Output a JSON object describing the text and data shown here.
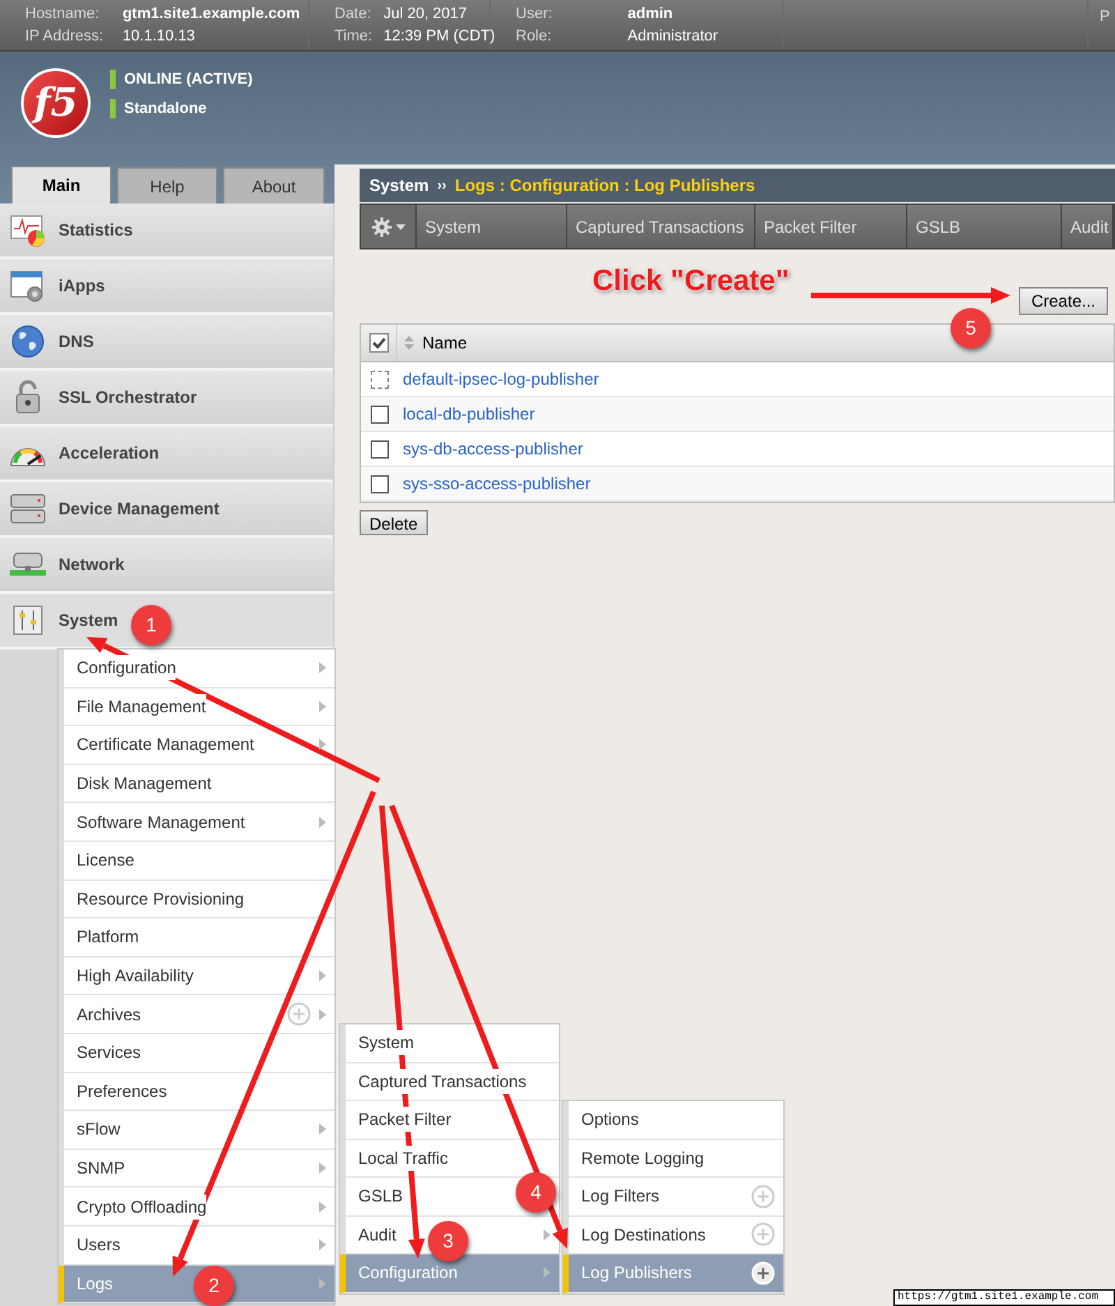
{
  "header": {
    "fields": [
      {
        "label": "Hostname:",
        "value": "gtm1.site1.example.com",
        "bold": true
      },
      {
        "label": "IP Address:",
        "value": "10.1.10.13",
        "bold": false
      },
      {
        "label": "Date:",
        "value": "Jul 20, 2017",
        "bold": false
      },
      {
        "label": "Time:",
        "value": "12:39 PM (CDT)",
        "bold": false
      },
      {
        "label": "User:",
        "value": "admin",
        "bold": true
      },
      {
        "label": "Role:",
        "value": "Administrator",
        "bold": false
      }
    ],
    "cut_text": "P"
  },
  "logo_text": "f5",
  "status": [
    "ONLINE (ACTIVE)",
    "Standalone"
  ],
  "nav_tabs": [
    {
      "label": "Main",
      "selected": true
    },
    {
      "label": "Help",
      "selected": false
    },
    {
      "label": "About",
      "selected": false
    }
  ],
  "nav_items": [
    {
      "label": "Statistics",
      "expanded": false
    },
    {
      "label": "iApps",
      "expanded": false
    },
    {
      "label": "DNS",
      "expanded": false
    },
    {
      "label": "SSL Orchestrator",
      "expanded": false
    },
    {
      "label": "Acceleration",
      "expanded": false
    },
    {
      "label": "Device Management",
      "expanded": false
    },
    {
      "label": "Network",
      "expanded": false
    },
    {
      "label": "System",
      "expanded": true
    }
  ],
  "breadcrumb": {
    "root": "System",
    "separator": "››",
    "path": "Logs : Configuration : Log Publishers"
  },
  "sub_tabs": [
    "System",
    "Captured Transactions",
    "Packet Filter",
    "GSLB",
    "Audit"
  ],
  "create_button": "Create...",
  "table": {
    "header": "Name",
    "header_checked": true,
    "rows": [
      {
        "name": "default-ipsec-log-publisher",
        "disabled": true
      },
      {
        "name": "local-db-publisher",
        "disabled": false
      },
      {
        "name": "sys-db-access-publisher",
        "disabled": false
      },
      {
        "name": "sys-sso-access-publisher",
        "disabled": false
      }
    ]
  },
  "delete_button": "Delete",
  "system_menu": [
    {
      "label": "Configuration",
      "submenu": true,
      "add": false,
      "selected": false
    },
    {
      "label": "File Management",
      "submenu": true,
      "add": false,
      "selected": false
    },
    {
      "label": "Certificate Management",
      "submenu": true,
      "add": false,
      "selected": false
    },
    {
      "label": "Disk Management",
      "submenu": false,
      "add": false,
      "selected": false
    },
    {
      "label": "Software Management",
      "submenu": true,
      "add": false,
      "selected": false
    },
    {
      "label": "License",
      "submenu": false,
      "add": false,
      "selected": false
    },
    {
      "label": "Resource Provisioning",
      "submenu": false,
      "add": false,
      "selected": false
    },
    {
      "label": "Platform",
      "submenu": false,
      "add": false,
      "selected": false
    },
    {
      "label": "High Availability",
      "submenu": true,
      "add": false,
      "selected": false
    },
    {
      "label": "Archives",
      "submenu": true,
      "add": true,
      "selected": false
    },
    {
      "label": "Services",
      "submenu": false,
      "add": false,
      "selected": false
    },
    {
      "label": "Preferences",
      "submenu": false,
      "add": false,
      "selected": false
    },
    {
      "label": "sFlow",
      "submenu": true,
      "add": false,
      "selected": false
    },
    {
      "label": "SNMP",
      "submenu": true,
      "add": false,
      "selected": false
    },
    {
      "label": "Crypto Offloading",
      "submenu": true,
      "add": false,
      "selected": false
    },
    {
      "label": "Users",
      "submenu": true,
      "add": false,
      "selected": false
    },
    {
      "label": "Logs",
      "submenu": true,
      "add": false,
      "selected": true
    }
  ],
  "logs_menu": [
    {
      "label": "System",
      "submenu": false,
      "add": false,
      "selected": false
    },
    {
      "label": "Captured Transactions",
      "submenu": false,
      "add": false,
      "selected": false
    },
    {
      "label": "Packet Filter",
      "submenu": false,
      "add": false,
      "selected": false
    },
    {
      "label": "Local Traffic",
      "submenu": false,
      "add": false,
      "selected": false
    },
    {
      "label": "GSLB",
      "submenu": false,
      "add": false,
      "selected": false
    },
    {
      "label": "Audit",
      "submenu": true,
      "add": false,
      "selected": false
    },
    {
      "label": "Configuration",
      "submenu": true,
      "add": false,
      "selected": true
    }
  ],
  "configuration_menu": [
    {
      "label": "Options",
      "submenu": false,
      "add": false,
      "selected": false
    },
    {
      "label": "Remote Logging",
      "submenu": false,
      "add": false,
      "selected": false
    },
    {
      "label": "Log Filters",
      "submenu": false,
      "add": true,
      "selected": false
    },
    {
      "label": "Log Destinations",
      "submenu": false,
      "add": true,
      "selected": false
    },
    {
      "label": "Log Publishers",
      "submenu": false,
      "add": true,
      "selected": true
    }
  ],
  "annotations": {
    "callout": "Click \"Create\"",
    "steps": [
      "1",
      "2",
      "3",
      "4",
      "5"
    ]
  },
  "status_url": "https://gtm1.site1.example.com"
}
